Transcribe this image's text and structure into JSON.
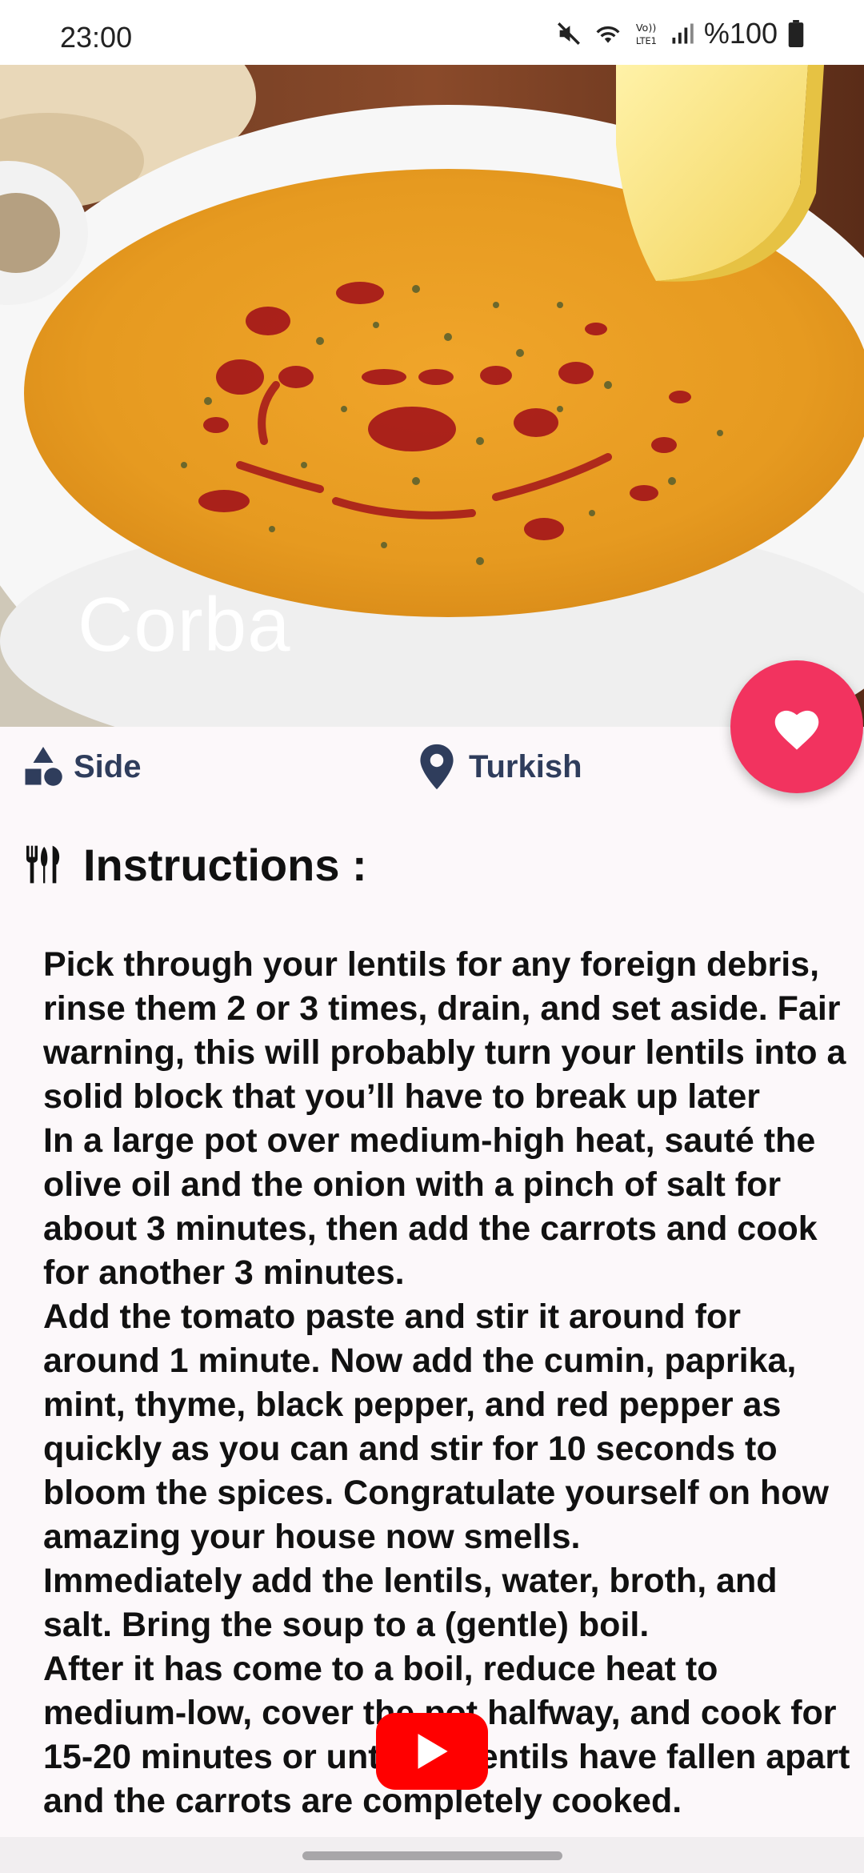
{
  "status_bar": {
    "time": "23:00",
    "battery": "%100",
    "network_label": "VoLTE1"
  },
  "meal": {
    "title": "Corba",
    "category": "Side",
    "area": "Turkish",
    "image_icon": "lentil-soup-photo"
  },
  "instructions": {
    "heading": "Instructions :",
    "text": "Pick through your lentils for any foreign debris, rinse them 2 or 3 times, drain, and set aside.  Fair warning, this will probably turn your lentils into a solid block that you’ll have to break up later\nIn a large pot over medium-high heat, sauté the olive oil and the onion with a pinch of salt for about 3 minutes, then add the carrots and cook for another 3 minutes.\nAdd the tomato paste and stir it around for around 1 minute. Now add the cumin, paprika, mint, thyme, black pepper, and red pepper as quickly as you can and stir for 10 seconds to bloom the spices. Congratulate yourself on how amazing your house now smells.\nImmediately add the lentils, water, broth, and salt. Bring the soup to a (gentle) boil.\nAfter it has come to a boil, reduce heat to medium-low, cover the pot halfway, and cook for 15-20 minutes or until the lentils have fallen apart and the carrots are completely cooked."
  },
  "colors": {
    "fab": "#f2335f",
    "meta_text": "#2f3d5c",
    "youtube": "#ff0000"
  },
  "icons": {
    "category": "shapes-icon",
    "area": "location-pin-icon",
    "instructions": "utensils-icon",
    "favorite": "heart-icon",
    "video": "youtube-play-icon"
  }
}
